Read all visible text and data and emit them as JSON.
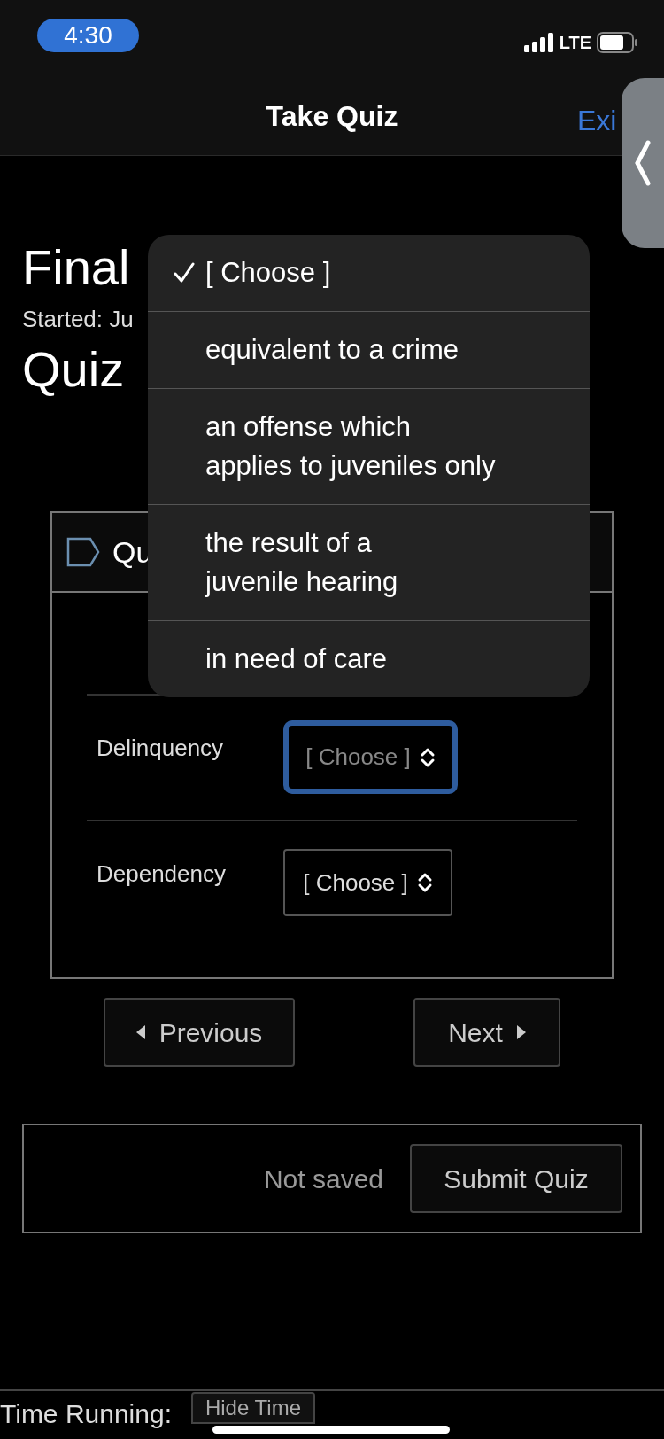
{
  "status_bar": {
    "time": "4:30",
    "network": "LTE"
  },
  "nav": {
    "title": "Take Quiz",
    "action": "Exi"
  },
  "quiz": {
    "title": "Final",
    "started": "Started: Ju",
    "heading": "Quiz"
  },
  "question": {
    "title": "Qu",
    "rows": [
      {
        "label": "Delinquency",
        "value": "[ Choose ]",
        "focused": true
      },
      {
        "label": "Dependency",
        "value": "[ Choose ]",
        "focused": false
      }
    ]
  },
  "pager": {
    "previous": "Previous",
    "next": "Next"
  },
  "footer": {
    "status": "Not saved",
    "submit": "Submit Quiz"
  },
  "timer": {
    "label": "Time Running:",
    "button": "Hide Time"
  },
  "picker": {
    "options": [
      {
        "label": "[ Choose ]",
        "selected": true
      },
      {
        "label": "equivalent to a crime",
        "selected": false
      },
      {
        "label": "an offense which applies to juveniles only",
        "selected": false
      },
      {
        "label": "the result of a juvenile hearing",
        "selected": false
      },
      {
        "label": "in need of care",
        "selected": false
      }
    ]
  }
}
